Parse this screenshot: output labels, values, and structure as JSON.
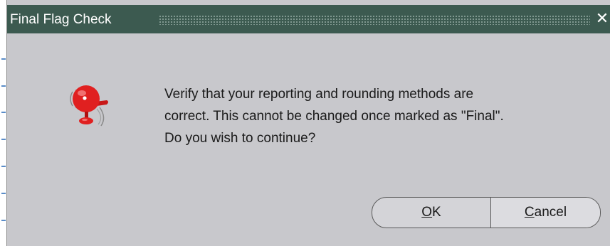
{
  "dialog": {
    "title": "Final Flag Check",
    "close_label": "✕",
    "icon": "alarm-bell-icon",
    "message_lines": [
      "Verify that your reporting and rounding methods are",
      "correct. This cannot be changed once marked as \"Final\".",
      "Do you wish to continue?"
    ],
    "ok": {
      "mnemonic": "O",
      "rest": "K"
    },
    "cancel": {
      "mnemonic": "C",
      "rest": "ancel"
    }
  },
  "colors": {
    "titlebar": "#3c5a50",
    "dialog_bg": "#c8c8cc",
    "bell_red": "#e02020"
  }
}
